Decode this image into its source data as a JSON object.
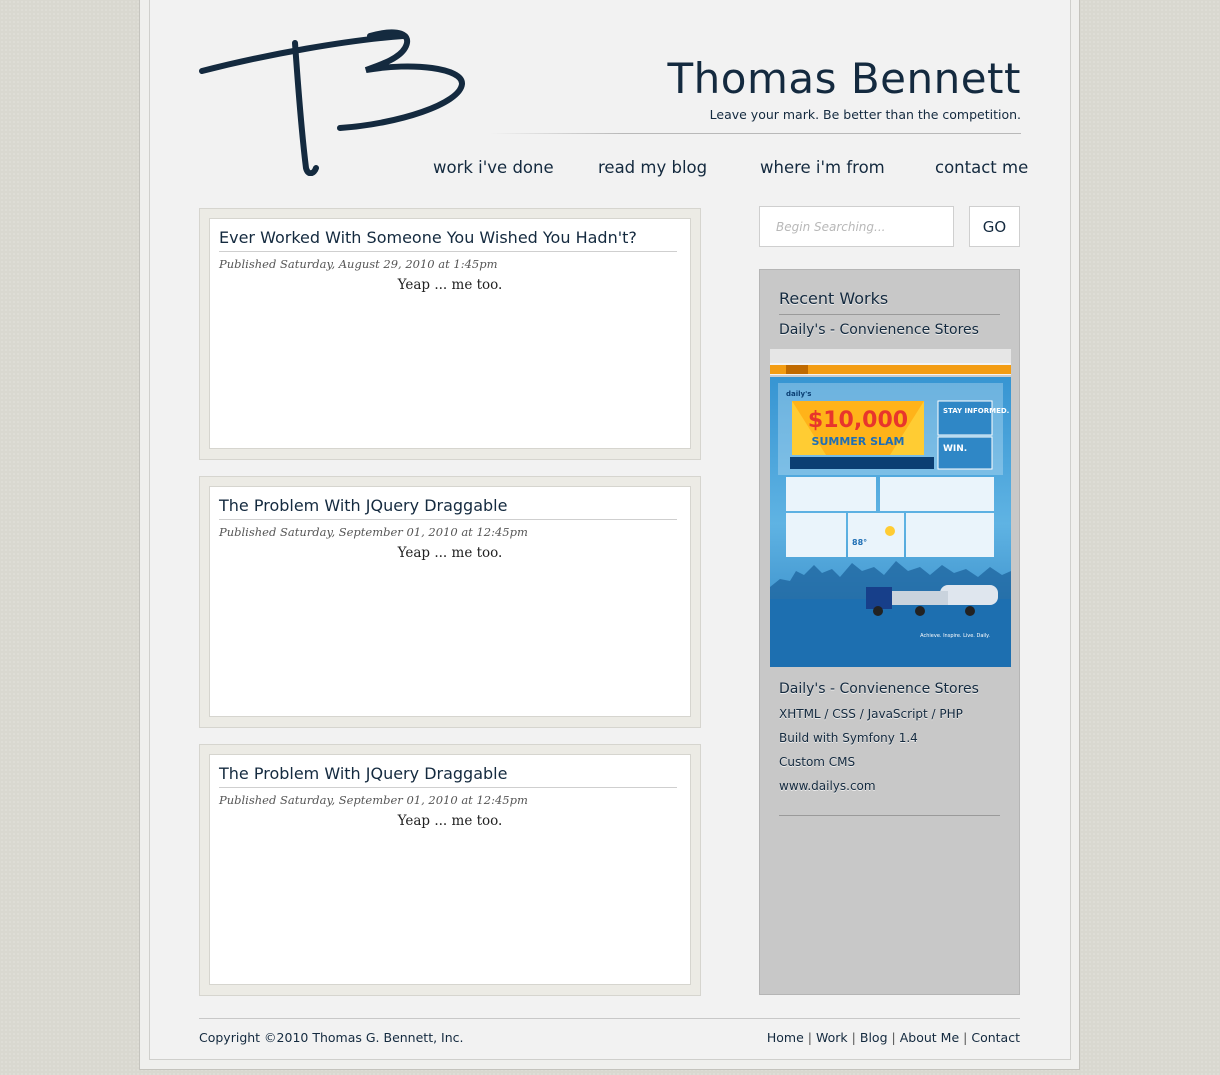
{
  "brand": {
    "logo_text": "TB",
    "title": "Thomas Bennett",
    "tagline": "Leave your mark. Be better than the competition."
  },
  "nav": {
    "items": [
      {
        "label": "work i've done"
      },
      {
        "label": "read my blog"
      },
      {
        "label": "where i'm from"
      },
      {
        "label": "contact me"
      }
    ]
  },
  "posts": [
    {
      "title": "Ever Worked With Someone You Wished You Hadn't?",
      "date": "Published Saturday, August 29, 2010 at 1:45pm",
      "body": "Yeap ... me too."
    },
    {
      "title": "The Problem With JQuery Draggable",
      "date": "Published Saturday, September 01, 2010 at 12:45pm",
      "body": "Yeap ... me too."
    },
    {
      "title": "The Problem With JQuery Draggable",
      "date": "Published Saturday, September 01, 2010 at 12:45pm",
      "body": "Yeap ... me too."
    }
  ],
  "search": {
    "placeholder": "Begin Searching...",
    "value": "",
    "button_label": "GO"
  },
  "sidebar": {
    "heading": "Recent Works",
    "work": {
      "title_top": "Daily's - Convienence Stores",
      "title": "Daily's - Convienence Stores",
      "details": [
        "XHTML / CSS / JavaScript / PHP",
        "Build with Symfony 1.4",
        "Custom CMS",
        "www.dailys.com"
      ],
      "thumbnail": {
        "site_logo": "daily's",
        "headline": "$10,000",
        "subheadline": "SUMMER SLAM",
        "promo_1": "STAY INFORMED.",
        "promo_2": "WIN.",
        "temperature": "88°",
        "tagline": "Achieve. Inspire. Live. Daily."
      }
    }
  },
  "footer": {
    "copyright": "Copyright ©2010 Thomas G. Bennett, Inc.",
    "links": [
      "Home",
      "Work",
      "Blog",
      "About Me",
      "Contact"
    ]
  },
  "colors": {
    "brand_navy": "#142a3f",
    "page_background": "#d9d8d0",
    "sidebar_background": "#c8c8c8",
    "thumb_orange": "#f39c12",
    "thumb_blue": "#3b9bd4"
  }
}
